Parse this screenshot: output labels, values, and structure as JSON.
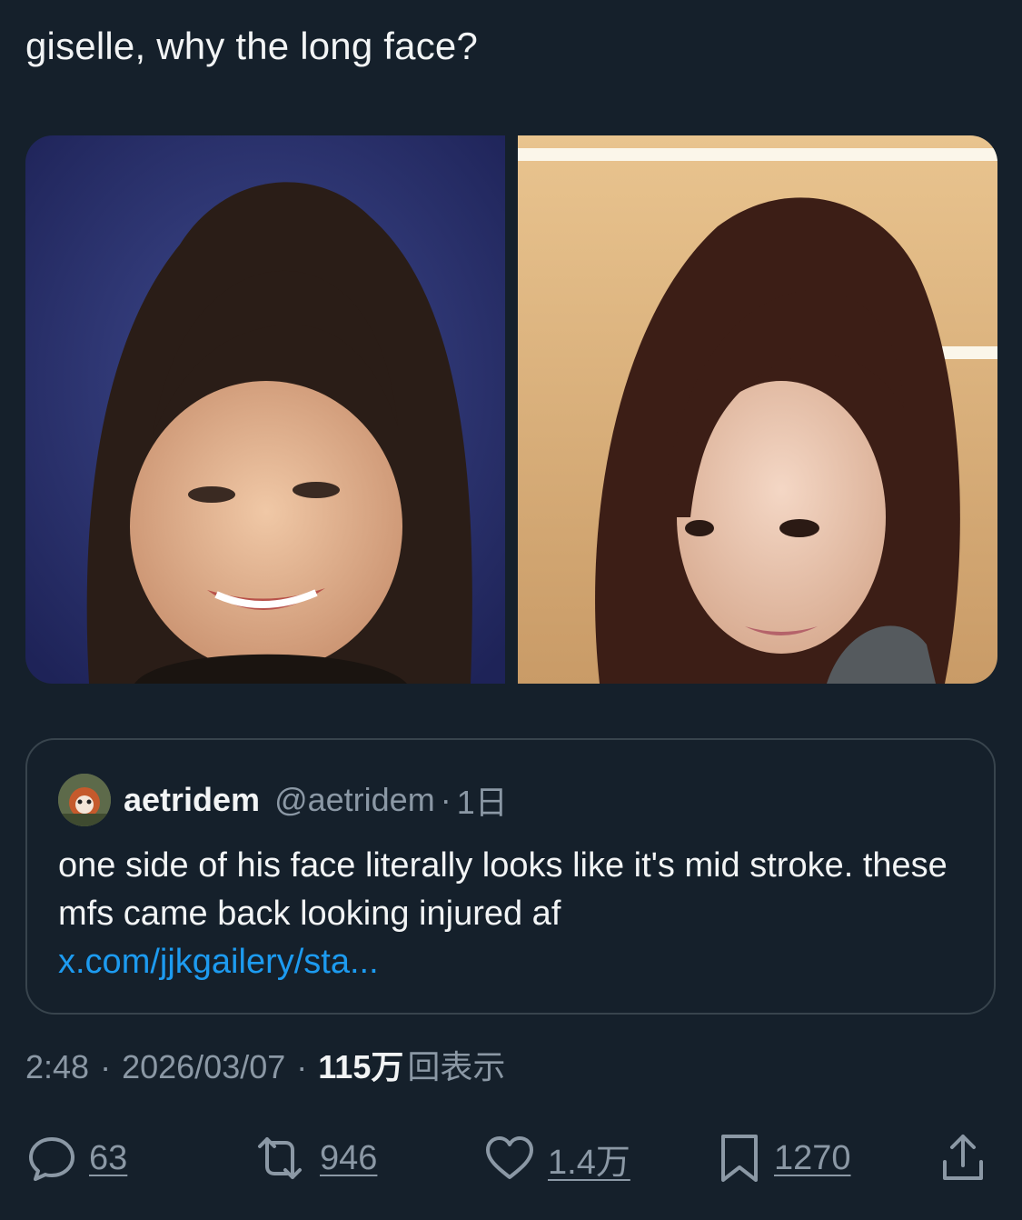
{
  "tweet": {
    "text": "giselle, why the long face?"
  },
  "quote": {
    "author_name": "aetridem",
    "author_handle": "@aetridem",
    "separator": "·",
    "time": "1日",
    "text": "one side of his face literally looks like it's mid stroke. these mfs came back looking injured af",
    "link": "x.com/jjkgailery/sta..."
  },
  "meta": {
    "time": "2:48",
    "date": "2026/03/07",
    "views_count": "115万",
    "views_label": "回表示",
    "sep": "·"
  },
  "actions": {
    "replies": "63",
    "reposts": "946",
    "likes": "1.4万",
    "bookmarks": "1270"
  },
  "colors": {
    "background": "#15202b",
    "text": "#f2f4f5",
    "secondary": "#8b98a5",
    "link": "#1d9bf0",
    "border": "#38444d"
  }
}
